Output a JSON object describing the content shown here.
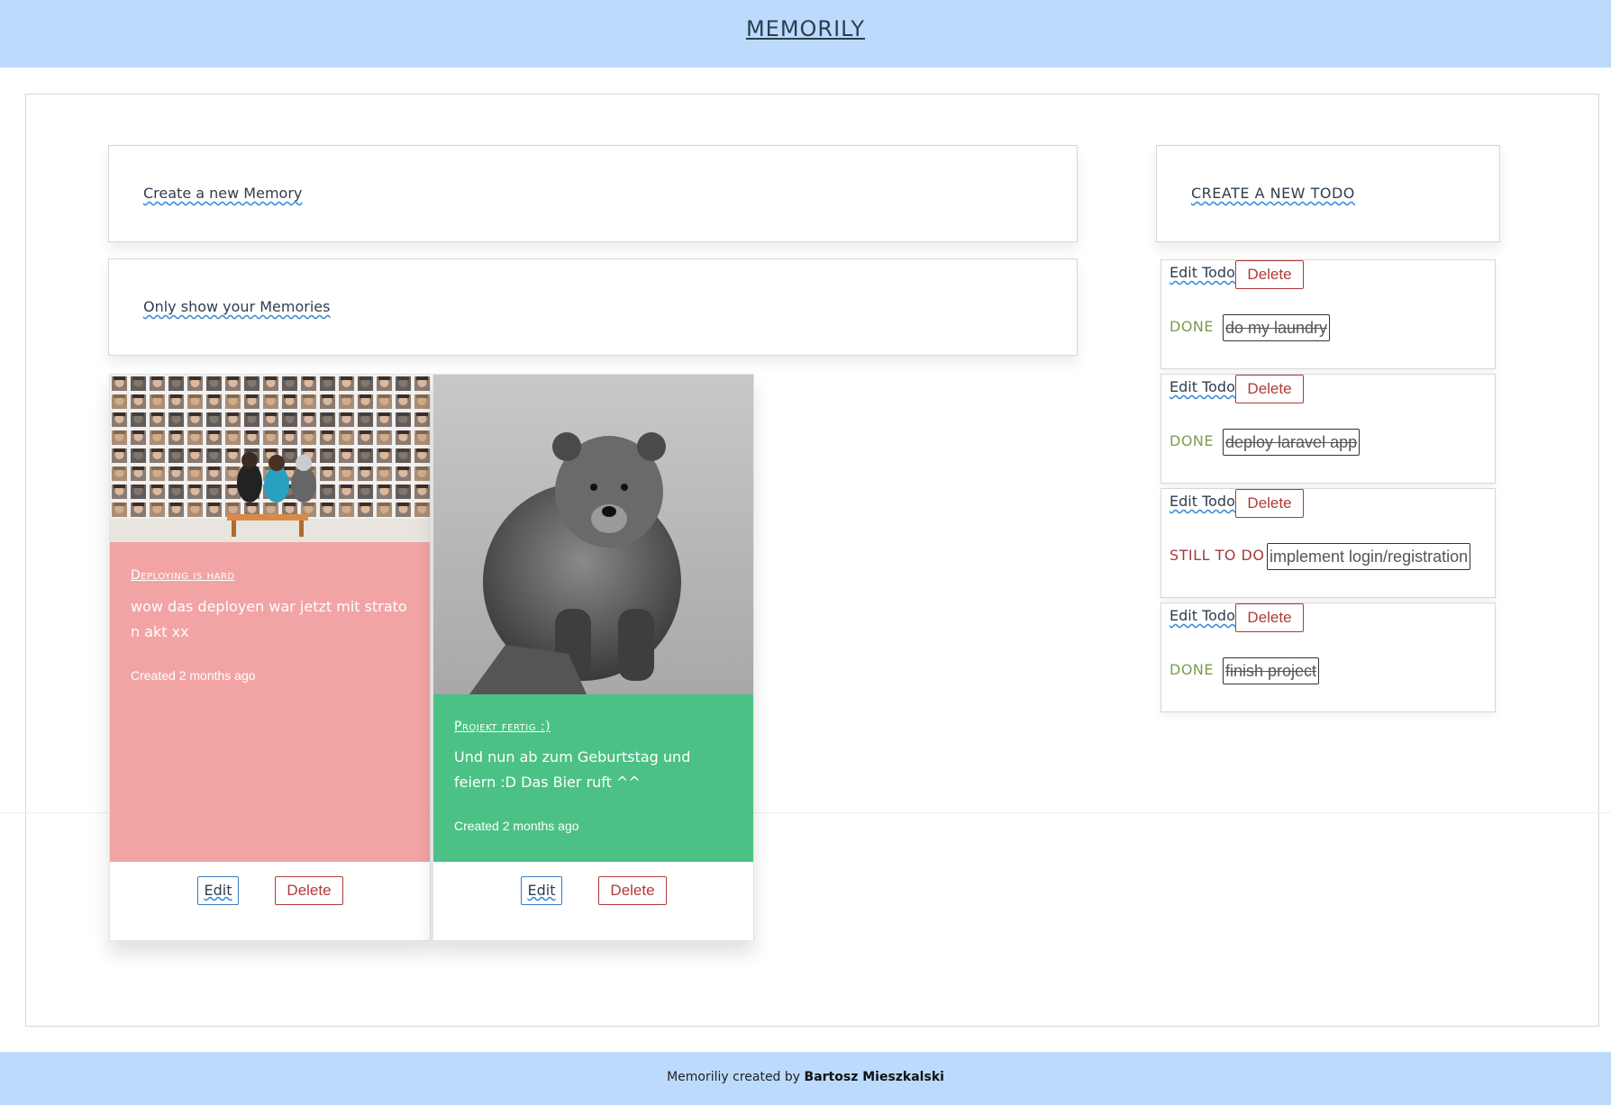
{
  "header": {
    "brand": "MEMORILY"
  },
  "actions": {
    "create_memory": "Create a new Memory",
    "only_my_memories": "Only show your Memories",
    "create_todo": "CREATE A NEW TODO"
  },
  "memories": [
    {
      "title": "Deploying is hard",
      "text": "wow das deployen war jetzt mit strato n akt xx",
      "created": "Created 2 months ago",
      "color": "#f2a4a4",
      "edit_label": "Edit",
      "delete_label": "Delete"
    },
    {
      "title": "Projekt fertig :)",
      "text": "Und nun ab zum Geburtstag und feiern :D Das Bier ruft ^^",
      "created": "Created 2 months ago",
      "color": "#4cc185",
      "edit_label": "Edit",
      "delete_label": "Delete"
    }
  ],
  "todos": [
    {
      "edit_label": "Edit Todo",
      "delete_label": "Delete",
      "status": "DONE",
      "task": "do my laundry"
    },
    {
      "edit_label": "Edit Todo",
      "delete_label": "Delete",
      "status": "DONE",
      "task": "deploy laravel app"
    },
    {
      "edit_label": "Edit Todo",
      "delete_label": "Delete",
      "status": "STILL TO DO",
      "task": "implement login/registration"
    },
    {
      "edit_label": "Edit Todo",
      "delete_label": "Delete",
      "status": "DONE",
      "task": "finish project"
    }
  ],
  "footer": {
    "prefix": "Memoriliy created by",
    "author": "Bartosz Mieszkalski"
  },
  "colors": {
    "topbar": "#bcdbfc",
    "done": "#7b9d4f",
    "todo": "#a33b3b",
    "delete": "#b03a3a",
    "edit": "#3b7bbf"
  }
}
